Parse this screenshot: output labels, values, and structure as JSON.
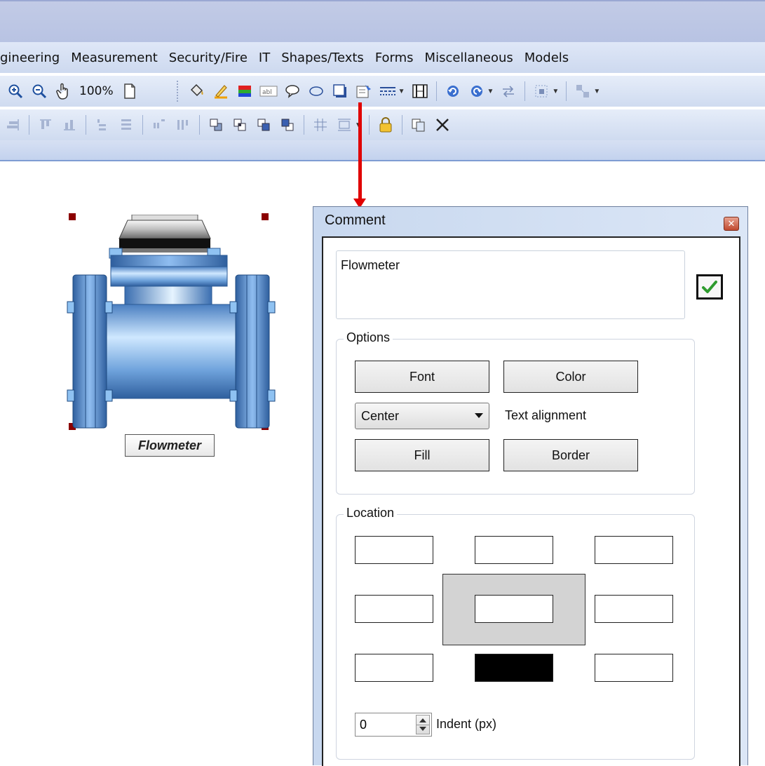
{
  "menubar": {
    "items": [
      "gineering",
      "Measurement",
      "Security/Fire",
      "IT",
      "Shapes/Texts",
      "Forms",
      "Miscellaneous",
      "Models"
    ]
  },
  "toolbar": {
    "zoom": "100%"
  },
  "canvas": {
    "shape_label": "Flowmeter"
  },
  "dialog": {
    "title": "Comment",
    "comment_text": "Flowmeter",
    "options": {
      "legend": "Options",
      "font_button": "Font",
      "color_button": "Color",
      "alignment_value": "Center",
      "alignment_label": "Text alignment",
      "fill_button": "Fill",
      "border_button": "Border"
    },
    "location": {
      "legend": "Location",
      "selected_cell": "bottom-center"
    },
    "indent": {
      "value": "0",
      "label": "Indent (px)"
    }
  },
  "colors": {
    "arrow": "#e00000",
    "handle": "#8b0000",
    "accent": "#2e9b2e"
  }
}
